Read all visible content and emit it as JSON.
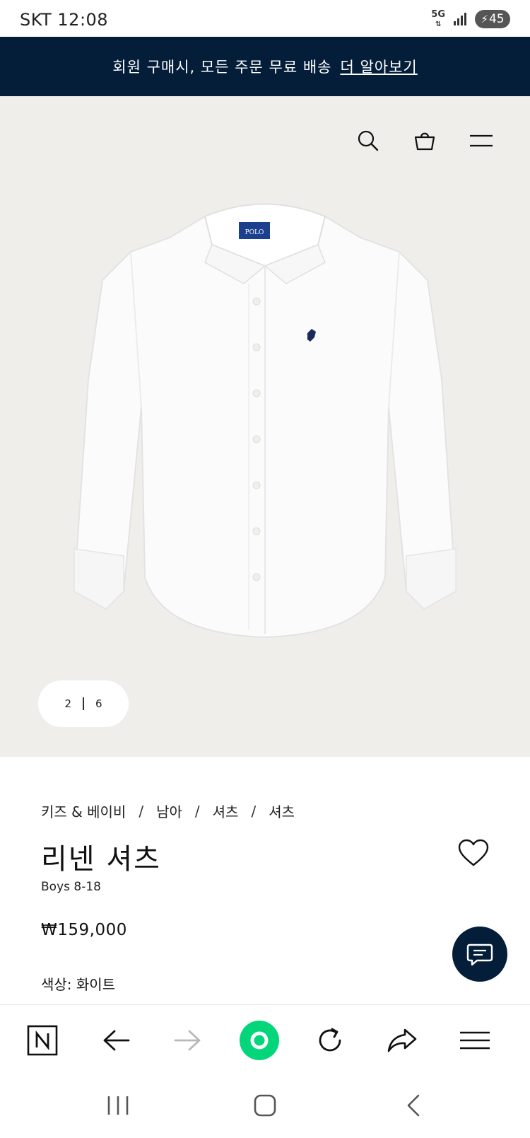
{
  "status_bar": {
    "carrier_time": "SKT 12:08",
    "network": "5G",
    "battery": "45"
  },
  "promo_banner": {
    "text": "회원 구매시, 모든 주문 무료 배송",
    "more_link": "더 알아보기"
  },
  "hero": {
    "pager": {
      "current": "2",
      "total": "6"
    },
    "shirt_logo": "POLO"
  },
  "product": {
    "breadcrumb": [
      "키즈 & 베이비",
      "남아",
      "셔츠",
      "셔츠"
    ],
    "title": "리넨 셔츠",
    "subtitle": "Boys 8-18",
    "price": "₩159,000",
    "color_label": "색상: 화이트"
  },
  "toolbar": {
    "icons": [
      "naver-n-icon",
      "back-arrow-icon",
      "forward-arrow-icon",
      "home-circle-icon",
      "refresh-icon",
      "share-icon",
      "menu-icon"
    ]
  },
  "colors": {
    "navy": "#041e3a",
    "hero_bg": "#efeeeb",
    "accent_green": "#03d67a"
  }
}
